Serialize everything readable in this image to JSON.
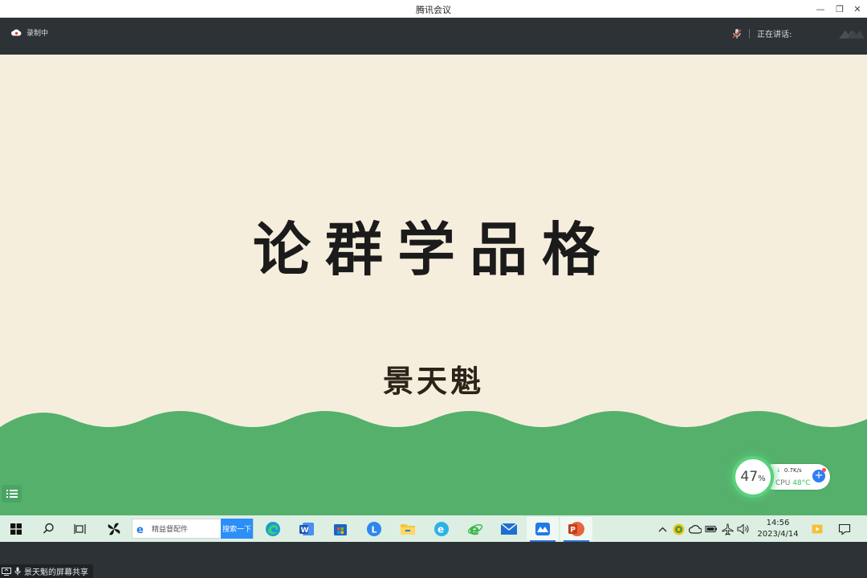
{
  "window": {
    "title": "腾讯会议"
  },
  "meeting": {
    "recording_label": "录制中",
    "speaking_label": "正在讲话:"
  },
  "slide": {
    "title": "论群学品格",
    "author": "景天魁",
    "background_color": "#f5eedd",
    "wave_color": "#55b06c"
  },
  "monitor_widget": {
    "percent": "47",
    "percent_unit": "%",
    "net_speed": "0.7K/s",
    "cpu_label": "CPU",
    "cpu_temp": "48°C"
  },
  "taskbar": {
    "search_text": "精益督配件",
    "search_button": "搜索一下",
    "apps": [
      "start-icon",
      "search-icon",
      "task-view-icon",
      "pinwheel-app-icon",
      "edge-icon",
      "word-icon",
      "store-icon",
      "l-app-icon",
      "file-explorer-icon",
      "e-browser-icon",
      "ie-icon",
      "mail-icon",
      "tencent-meeting-icon",
      "powerpoint-icon"
    ]
  },
  "clock": {
    "time": "14:56",
    "date": "2023/4/14"
  },
  "share_tag": {
    "label": "景天魁的屏幕共享"
  }
}
